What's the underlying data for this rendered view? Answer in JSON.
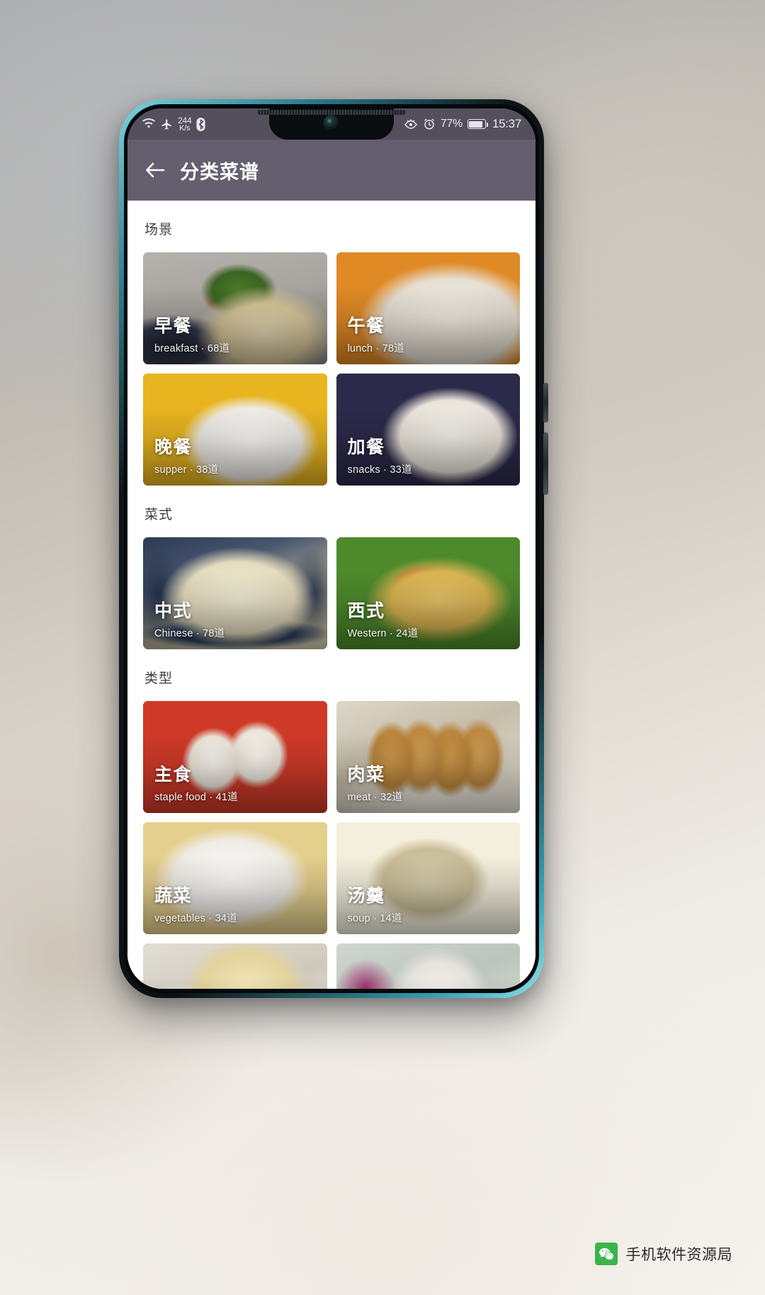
{
  "statusbar": {
    "icons_left": [
      "wifi-icon",
      "airplane-mode-icon",
      "bluetooth-icon"
    ],
    "network_speed_value": "244",
    "network_speed_unit": "K/s",
    "icons_right": [
      "eye-comfort-icon",
      "alarm-clock-icon"
    ],
    "battery_percent": "77%",
    "time": "15:37"
  },
  "appbar": {
    "back_icon": "back-arrow-icon",
    "title": "分类菜谱"
  },
  "sections": [
    {
      "title": "场景",
      "cards": [
        {
          "title": "早餐",
          "subtitle": "breakfast · 68道",
          "photo": "p-breakfast"
        },
        {
          "title": "午餐",
          "subtitle": "lunch · 78道",
          "photo": "p-lunch"
        },
        {
          "title": "晚餐",
          "subtitle": "supper · 38道",
          "photo": "p-supper"
        },
        {
          "title": "加餐",
          "subtitle": "snacks · 33道",
          "photo": "p-snacks"
        }
      ]
    },
    {
      "title": "菜式",
      "cards": [
        {
          "title": "中式",
          "subtitle": "Chinese · 78道",
          "photo": "p-chinese"
        },
        {
          "title": "西式",
          "subtitle": "Western · 24道",
          "photo": "p-western"
        }
      ]
    },
    {
      "title": "类型",
      "cards": [
        {
          "title": "主食",
          "subtitle": "staple food · 41道",
          "photo": "p-staple"
        },
        {
          "title": "肉菜",
          "subtitle": "meat · 32道",
          "photo": "p-meat"
        },
        {
          "title": "蔬菜",
          "subtitle": "vegetables · 34道",
          "photo": "p-veg"
        },
        {
          "title": "汤羹",
          "subtitle": "soup · 14道",
          "photo": "p-soup"
        },
        {
          "title": "",
          "subtitle": "",
          "photo": "p-extra1"
        },
        {
          "title": "",
          "subtitle": "",
          "photo": "p-extra2"
        }
      ]
    }
  ],
  "watermark": {
    "logo": "wechat-icon",
    "text": "手机软件资源局"
  },
  "colors": {
    "statusbar_bg": "#544f5c",
    "appbar_bg": "#655e6e",
    "content_bg": "#ffffff",
    "section_title": "#3d3d3d",
    "card_title": "#ffffff",
    "wechat_green": "#3bb44a"
  }
}
